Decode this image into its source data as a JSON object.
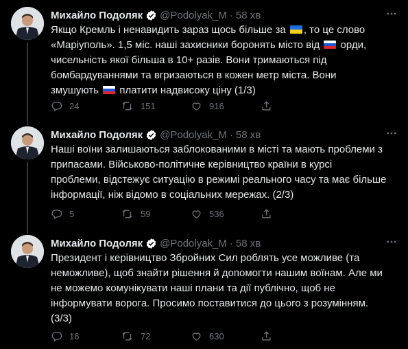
{
  "colors": {
    "background": "#000000",
    "text": "#e7e9ea",
    "muted": "#71767b",
    "verified": "#ffffff",
    "thread_line": "#333639"
  },
  "tweets": [
    {
      "author": "Михайло Подоляк",
      "handle": "@Podolyak_M",
      "separator": "·",
      "time": "58 хв",
      "text_parts": [
        "Якщо Кремль і ненавидить зараз щось більше за ",
        ", то це слово\n«Маріуполь». 1,5 міс. наші захисники боронять місто від ",
        " орди,\nчисельність якої більша в 10+ разів. Вони тримаються під\nбомбардуваннями та вгризаються в кожен метр міста. Вони\nзмушують ",
        " платити надвисоку ціну (1/3)"
      ],
      "flags": [
        "flag-ukraine-icon",
        "flag-russia-icon",
        "flag-russia-icon"
      ],
      "replies": "24",
      "retweets": "151",
      "likes": "916"
    },
    {
      "author": "Михайло Подоляк",
      "handle": "@Podolyak_M",
      "separator": "·",
      "time": "58 хв",
      "text": "Наші воїни залишаються заблокованими в місті та мають проблеми з\nприпасами. Військово-політичне керівництво країни в курсі\nпроблеми, відстежує ситуацію в режимі реального часу та має більше\nінформації, ніж відомо в соціальних мережах. (2/3)",
      "replies": "5",
      "retweets": "59",
      "likes": "536"
    },
    {
      "author": "Михайло Подоляк",
      "handle": "@Podolyak_M",
      "separator": "·",
      "time": "58 хв",
      "text": "Президент і керівництво Збройних Сил роблять усе можливе (та\nнеможливе), щоб знайти рішення й допомогти нашим воїнам. Але ми\nне можемо комунікувати наші плани та дії публічно, щоб не\nінформувати ворога. Просимо поставитися до цього з розумінням.\n(3/3)",
      "replies": "16",
      "retweets": "72",
      "likes": "630"
    }
  ]
}
